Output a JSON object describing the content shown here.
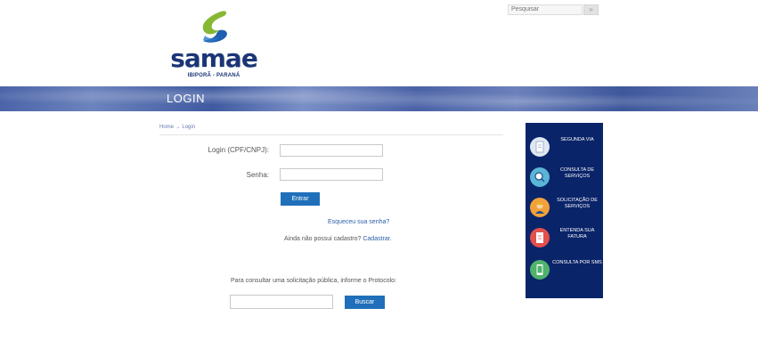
{
  "search": {
    "placeholder": "Pesquisar",
    "button": "»"
  },
  "logo": {
    "name": "samae",
    "subtitle": "IBIPORÃ - PARANÁ"
  },
  "banner": {
    "title": "LOGIN"
  },
  "breadcrumb": {
    "home": "Home",
    "separator": "→",
    "current": "Login"
  },
  "form": {
    "login_label": "Login (CPF/CNPJ):",
    "login_value": "",
    "password_label": "Senha:",
    "password_value": "",
    "submit_label": "Entrar",
    "forgot_link": "Esqueceu sua senha?",
    "signup_text": "Ainda não possui cadastro?",
    "signup_link": "Cadastrar."
  },
  "protocol": {
    "prompt": "Para consultar uma solicitação pública, informe o Protocolo:",
    "value": "",
    "button": "Buscar"
  },
  "sidebar": {
    "items": [
      {
        "label": "Segunda via",
        "icon": "document-icon"
      },
      {
        "label": "Consulta de serviços",
        "icon": "magnifier-icon"
      },
      {
        "label": "Solicitação de serviços",
        "icon": "worker-icon"
      },
      {
        "label": "Entenda sua fatura",
        "icon": "bill-icon"
      },
      {
        "label": "Consulta por SMS",
        "icon": "phone-icon"
      }
    ]
  },
  "colors": {
    "brand": "#1b3576",
    "sidebar_bg": "#0a2469",
    "button": "#1f6fba",
    "link": "#2b5fa8",
    "logo_green": "#86b833",
    "logo_blue": "#1f5fb0"
  }
}
